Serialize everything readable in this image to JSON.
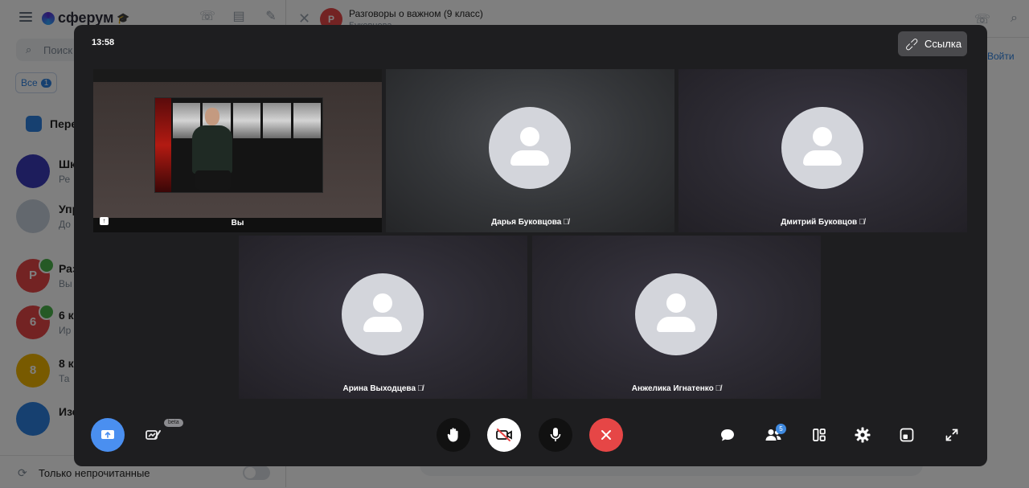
{
  "background_app": {
    "logo_text": "сферум",
    "search_placeholder": "Поиск",
    "filter_all": "Все",
    "filter_count": "1",
    "chats": [
      {
        "initial": "",
        "name": "Пере",
        "subtitle": "",
        "color": "#2d81e0"
      },
      {
        "initial": "",
        "name": "Шк",
        "subtitle": "Ре",
        "color": "#3b3bb8"
      },
      {
        "initial": "",
        "name": "Упр",
        "subtitle": "До",
        "color": "#c7d0dc"
      },
      {
        "initial": "Р",
        "name": "Раз",
        "subtitle": "Вы",
        "color": "#e64646"
      },
      {
        "initial": "6",
        "name": "6 к",
        "subtitle": "Ир",
        "color": "#e64646"
      },
      {
        "initial": "8",
        "name": "8 к",
        "subtitle": "Та",
        "color": "#f0b400"
      },
      {
        "initial": "",
        "name": "Изо",
        "subtitle": "",
        "color": "#2d81e0"
      }
    ],
    "unread_only_label": "Только непрочитанные",
    "chat_header_initial": "Р",
    "chat_header_title": "Разговоры о важном (9 класс)",
    "chat_header_subtitle": "Буковцова...",
    "join_link": "Войти"
  },
  "call": {
    "timer": "13:58",
    "link_button": "Ссылка",
    "self_label": "Вы",
    "participants": [
      {
        "name": "Дарья Буковцова",
        "muted": true
      },
      {
        "name": "Дмитрий Буковцов",
        "muted": true
      },
      {
        "name": "Арина Выходцева",
        "muted": true
      },
      {
        "name": "Анжелика Игнатенко",
        "muted": true
      }
    ],
    "toolbar": {
      "beta_label": "beta",
      "participants_count": "5"
    },
    "icons": {
      "share": "screen-share-icon",
      "draw": "drawing-icon",
      "hand": "raise-hand-icon",
      "camera": "camera-off-icon",
      "mic": "microphone-icon",
      "hangup": "hang-up-icon",
      "chat": "chat-bubble-icon",
      "people": "participants-icon",
      "layout": "layout-grid-icon",
      "settings": "gear-icon",
      "pip": "picture-in-picture-icon",
      "fullscreen": "fullscreen-icon"
    },
    "colors": {
      "share_button": "#4a8ff0",
      "hangup_button": "#e64646",
      "camera_button": "#ffffff",
      "dark_button": "#111111"
    }
  }
}
